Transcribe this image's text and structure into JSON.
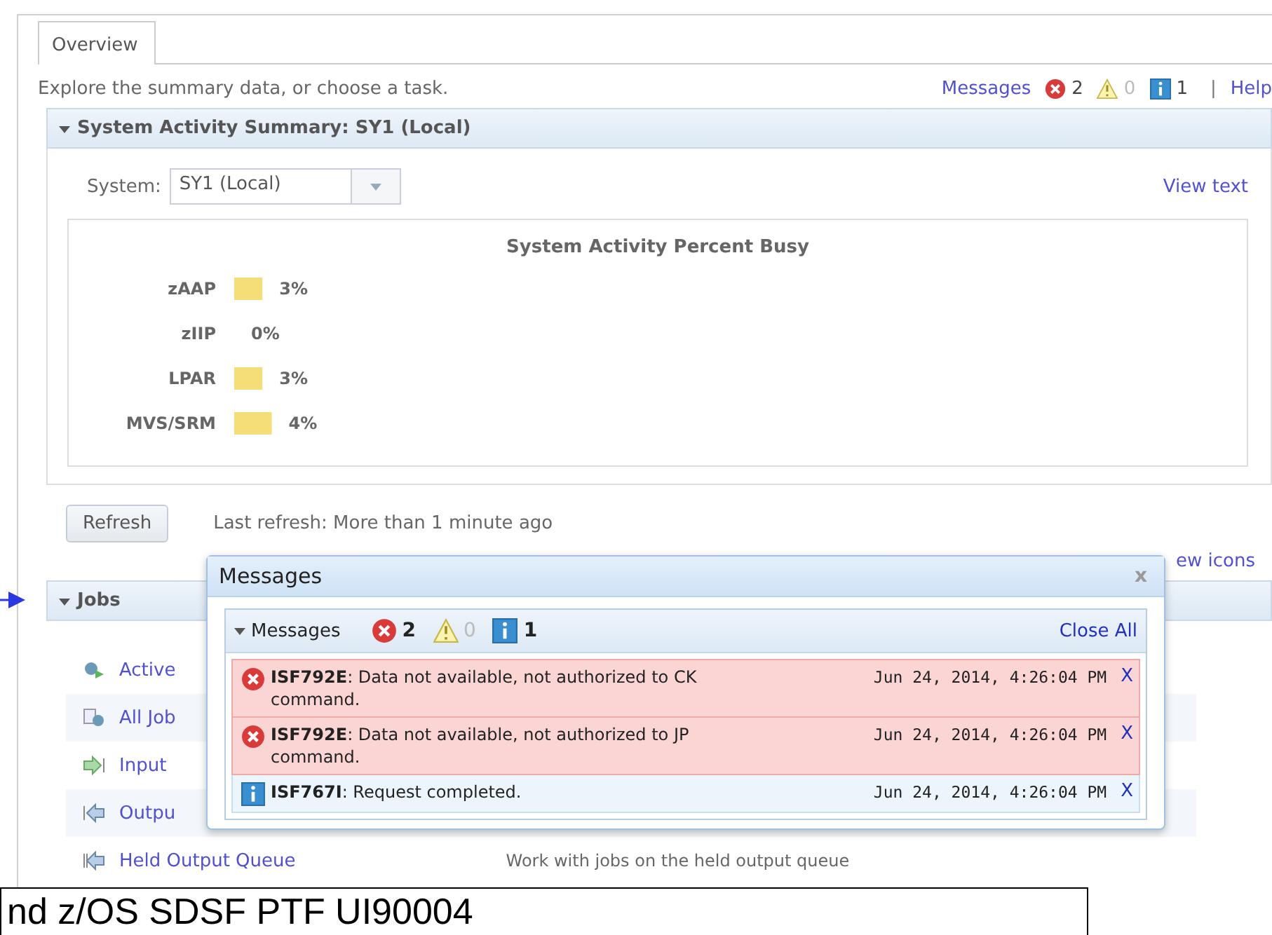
{
  "tabs": [
    {
      "label": "Overview",
      "selected": true
    }
  ],
  "intro": "Explore the summary data, or choose a task.",
  "message_bar": {
    "link": "Messages",
    "errors": "2",
    "warnings": "0",
    "info": "1",
    "separator": "|",
    "help": "Help"
  },
  "summary": {
    "title": "System Activity Summary: SY1 (Local)",
    "expanded": true,
    "system_label": "System:",
    "system_value": "SY1 (Local)",
    "view_text": "View text",
    "chart_data": {
      "type": "bar",
      "orientation": "horizontal",
      "title": "System Activity Percent Busy",
      "categories": [
        "zAAP",
        "zIIP",
        "LPAR",
        "MVS/SRM"
      ],
      "values": [
        3,
        0,
        3,
        4
      ],
      "value_labels": [
        "3%",
        "0%",
        "3%",
        "4%"
      ],
      "data_labels": true
    }
  },
  "refresh": {
    "button": "Refresh",
    "status": "Last refresh: More than 1 minute ago"
  },
  "view_icons": "ew icons",
  "jobs": {
    "title": "Jobs",
    "expanded": true,
    "items": [
      {
        "kind": "active",
        "label": "Active"
      },
      {
        "kind": "all",
        "label": "All Job"
      },
      {
        "kind": "input",
        "label": "Input"
      },
      {
        "kind": "output",
        "label": "Outpu"
      },
      {
        "kind": "held",
        "label": "Held Output Queue",
        "description": "Work with jobs on the held output queue"
      }
    ]
  },
  "dialog": {
    "title": "Messages",
    "close": "x",
    "panel": {
      "title": "Messages",
      "expanded": true,
      "errors": "2",
      "warnings": "0",
      "info": "1",
      "close_all": "Close All",
      "messages": [
        {
          "kind": "error",
          "text": "**ISF792E**: Data not available, not authorized to CK command.",
          "time": "Jun 24, 2014, 4:26:04 PM",
          "dismiss": "X"
        },
        {
          "kind": "error",
          "text": "**ISF792E**: Data not available, not authorized to JP command.",
          "time": "Jun 24, 2014, 4:26:04 PM",
          "dismiss": "X"
        },
        {
          "kind": "info",
          "text": "**ISF767I**: Request completed.",
          "time": "Jun 24, 2014, 4:26:04 PM",
          "dismiss": "X"
        }
      ]
    }
  },
  "caption": "nd z/OS SDSF PTF UI90004"
}
